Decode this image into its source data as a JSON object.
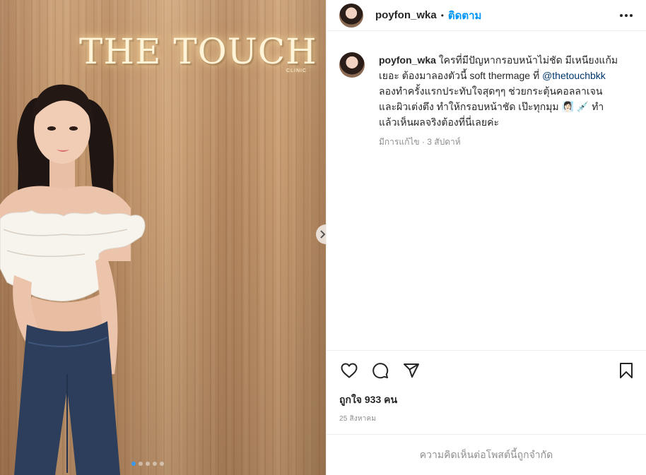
{
  "media": {
    "sign_text": "THE TOUCH",
    "sign_subtext": "CLINIC",
    "carousel": {
      "count": 5,
      "current": 1
    }
  },
  "header": {
    "username": "poyfon_wka",
    "separator": "•",
    "follow_label": "ติดตาม"
  },
  "caption": {
    "username": "poyfon_wka",
    "text_before": "ใครที่มีปัญหากรอบหน้าไม่ชัด มีเหนียงแก้มเยอะ ต้องมาลองตัวนี้ soft thermage ที่ ",
    "mention": "@thetouchbkk",
    "text_after": " ลองทำครั้งแรกประทับใจสุดๆๆ ช่วยกระตุ้นคอลลาเจนและผิวเต่งตึง ทำให้กรอบหน้าชัด เป๊ะทุกมุม 🧖🏻‍♀️ 💉  ทำแล้วเห็นผลจริงต้องที่นี่เลยค่ะ",
    "meta": "มีการแก้ไข · 3 สัปดาห์"
  },
  "stats": {
    "likes": "ถูกใจ 933 คน",
    "date": "25 สิงหาคม"
  },
  "footer": {
    "comments_limited": "ความคิดเห็นต่อโพสต์นี้ถูกจำกัด"
  },
  "colors": {
    "accent": "#0095f6",
    "mention": "#00376b",
    "muted": "#8e8e8e"
  },
  "icons": [
    "more-horizontal-icon",
    "heart-icon",
    "comment-icon",
    "share-icon",
    "bookmark-icon",
    "next-arrow-icon"
  ]
}
